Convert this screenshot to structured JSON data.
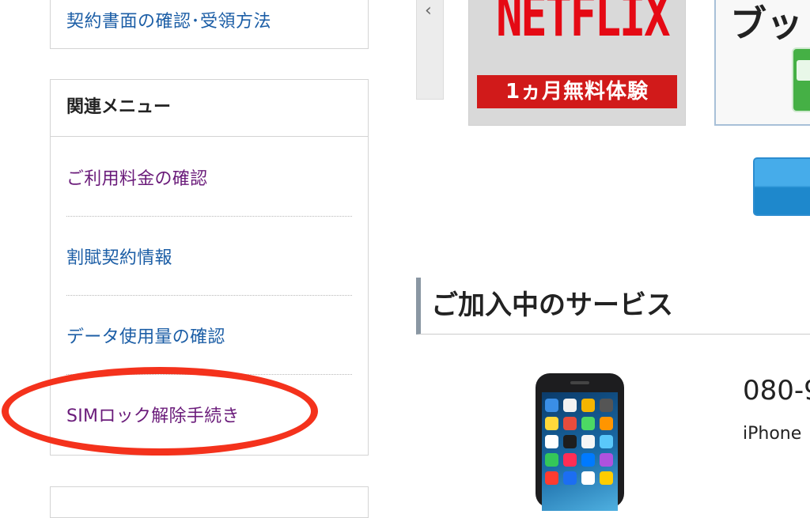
{
  "sidebar": {
    "top_link": "契約書面の確認･受領方法",
    "menu_title": "関連メニュー",
    "items": [
      {
        "label": "ご利用料金の確認",
        "color": "#6a1b7a"
      },
      {
        "label": "割賦契約情報",
        "color": "#1c5ea6"
      },
      {
        "label": "データ使用量の確認",
        "color": "#1c5ea6"
      },
      {
        "label": "SIMロック解除手続き",
        "color": "#6a1b7a",
        "highlighted": true
      }
    ]
  },
  "carousel": {
    "prev_icon": "chevron-left-icon",
    "prev_glyph": "‹",
    "banners": [
      {
        "logo": "NETFLIX",
        "caption": "1ヵ月無料体験"
      },
      {
        "text": "ブッ"
      }
    ]
  },
  "main": {
    "section_title": "ご加入中のサービス",
    "service": {
      "number": "080-9",
      "model": "iPhone"
    }
  },
  "colors": {
    "highlight_circle": "#f4321c",
    "link_blue": "#1c5ea6",
    "link_visited": "#6a1b7a",
    "netflix_red": "#e50914"
  }
}
